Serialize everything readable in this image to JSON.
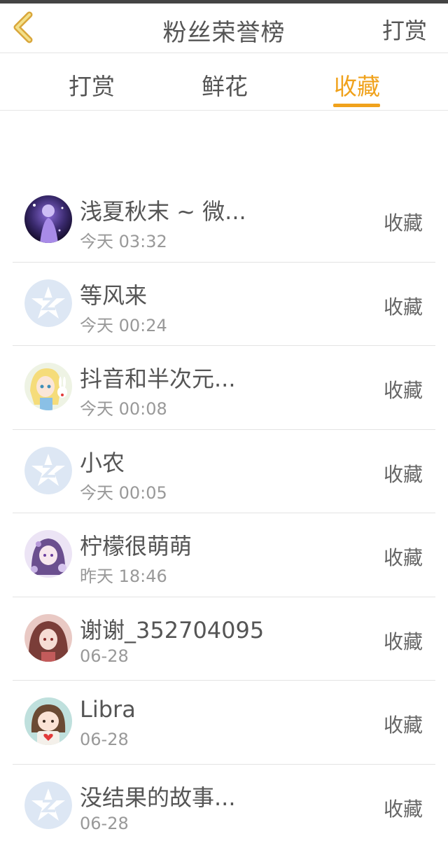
{
  "header": {
    "title": "粉丝荣誉榜",
    "right_button": "打赏"
  },
  "tabs": [
    {
      "label": "打赏",
      "active": false
    },
    {
      "label": "鲜花",
      "active": false
    },
    {
      "label": "收藏",
      "active": true
    }
  ],
  "colors": {
    "accent": "#f0a21c",
    "default_avatar": "#dbe5f3"
  },
  "fans": [
    {
      "name": "浅夏秋末 ~ 微...",
      "time": "今天 03:32",
      "action": "收藏",
      "avatar": "photo-purple-girl"
    },
    {
      "name": "等风来",
      "time": "今天 00:24",
      "action": "收藏",
      "avatar": "default-star"
    },
    {
      "name": "抖音和半次元...",
      "time": "今天 00:08",
      "action": "收藏",
      "avatar": "anime-blonde-rabbit"
    },
    {
      "name": "小农",
      "time": "今天 00:05",
      "action": "收藏",
      "avatar": "default-star"
    },
    {
      "name": "柠檬很萌萌",
      "time": "昨天 18:46",
      "action": "收藏",
      "avatar": "anime-purple-girl"
    },
    {
      "name": "谢谢_352704095",
      "time": "06-28",
      "action": "收藏",
      "avatar": "anime-red-girl"
    },
    {
      "name": "Libra",
      "time": "06-28",
      "action": "收藏",
      "avatar": "cartoon-heart-girl"
    },
    {
      "name": "没结果的故事...",
      "time": "06-28",
      "action": "收藏",
      "avatar": "default-star"
    }
  ]
}
